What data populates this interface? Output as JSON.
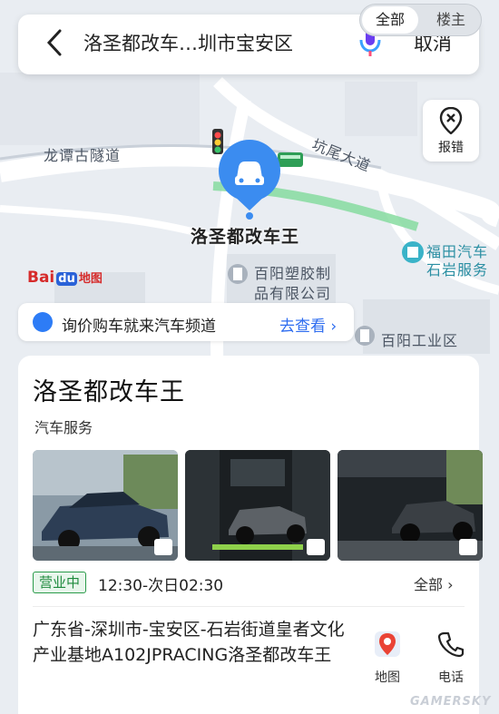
{
  "search": {
    "query": "洛圣都改车…圳市宝安区",
    "cancel_label": "取消"
  },
  "scope_toggle": {
    "all_label": "全部",
    "floor_label": "楼主"
  },
  "map": {
    "report_label": "报错",
    "road_labels": {
      "tunnel": "龙谭古隧道",
      "avenue": "坑尾大道"
    },
    "poi_name": "洛圣都改车王",
    "nearby": {
      "factory_line1": "百阳塑胶制",
      "factory_line2": "品有限公司",
      "industrial_zone": "百阳工业区",
      "dealer_line1": "福田汽车",
      "dealer_line2": "石岩服务"
    },
    "logo": {
      "bai": "Bai",
      "du": "du",
      "ditu": "地图"
    }
  },
  "promo": {
    "text": "询价购车就来汽车频道",
    "link": "去查看 ›"
  },
  "place": {
    "name": "洛圣都改车王",
    "category": "汽车服务",
    "status": "营业中",
    "hours": "12:30-次日02:30",
    "hours_all": "全部 ›",
    "address": "广东省-深圳市-宝安区-石岩街道皇者文化产业基地A102JPRACING洛圣都改车王"
  },
  "actions": {
    "map_label": "地图",
    "call_label": "电话"
  },
  "watermark": "GAMERSKY",
  "colors": {
    "accent_blue": "#2d7cf6",
    "open_green": "#1e8a3d",
    "pin_blue": "#3b8cf0"
  }
}
